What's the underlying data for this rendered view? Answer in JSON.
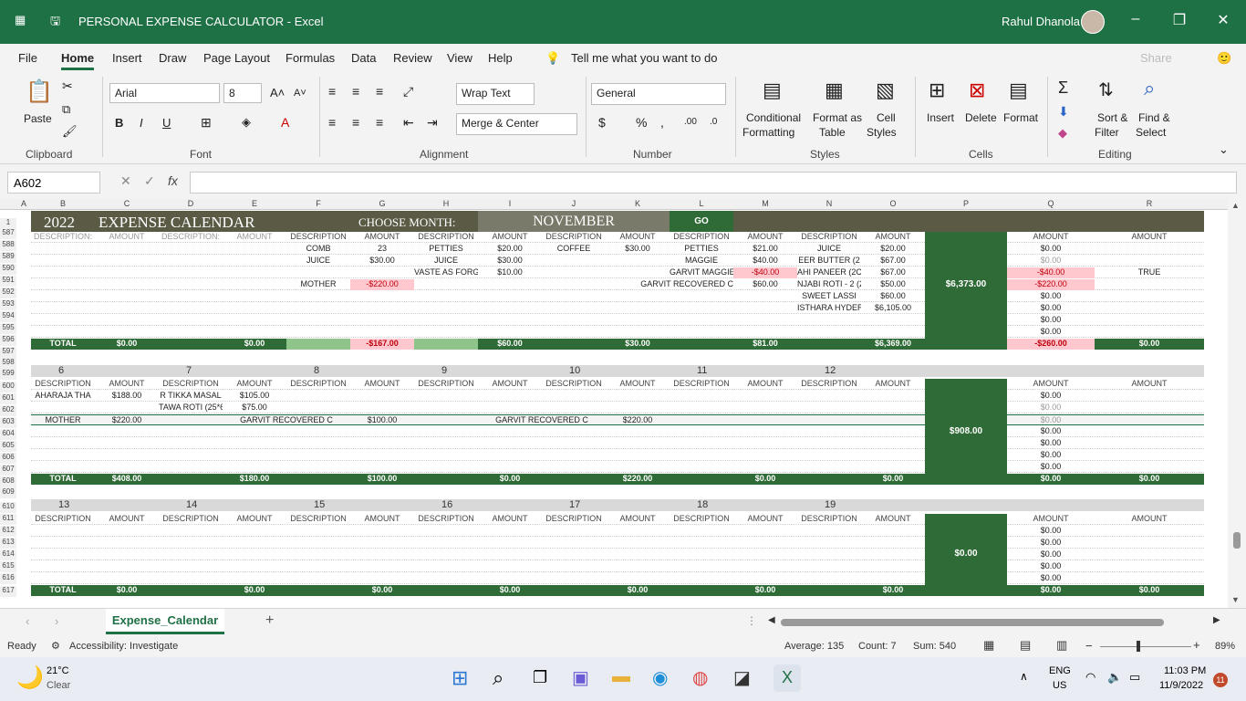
{
  "window": {
    "title": "PERSONAL EXPENSE CALCULATOR  -  Excel",
    "user": "Rahul Dhanola"
  },
  "menu": [
    "File",
    "Home",
    "Insert",
    "Draw",
    "Page Layout",
    "Formulas",
    "Data",
    "Review",
    "View",
    "Help",
    "Tell me what you want to do"
  ],
  "share": "Share",
  "ribbon": {
    "paste": "Paste",
    "clipboard": "Clipboard",
    "font_name": "Arial",
    "font_size": "8",
    "font": "Font",
    "wrap": "Wrap Text",
    "merge": "Merge & Center",
    "alignment": "Alignment",
    "number_format": "General",
    "number": "Number",
    "cond1": "Conditional",
    "cond2": "Formatting",
    "fmt1": "Format as",
    "fmt2": "Table",
    "cs1": "Cell",
    "cs2": "Styles",
    "styles": "Styles",
    "insert": "Insert",
    "delete": "Delete",
    "format": "Format",
    "cells": "Cells",
    "sort1": "Sort &",
    "sort2": "Filter",
    "find1": "Find &",
    "find2": "Select",
    "editing": "Editing"
  },
  "namebox": "A602",
  "columns": [
    "A",
    "B",
    "C",
    "D",
    "E",
    "F",
    "G",
    "H",
    "I",
    "J",
    "K",
    "L",
    "M",
    "N",
    "O",
    "P",
    "Q",
    "R"
  ],
  "banner": {
    "year": "2022",
    "title": "EXPENSE CALENDAR",
    "choose": "CHOOSE MONTH:",
    "month": "NOVEMBER",
    "go": "GO"
  },
  "headers": {
    "desc": "DESCRIPTION",
    "desc_short": "DESCRIPTION:",
    "amount": "AMOUNT",
    "total": "TOTAL"
  },
  "rows": {
    "r588": [
      "COMB",
      "23",
      "PETTIES",
      "$20.00",
      "COFFEE",
      "$30.00",
      "PETTIES",
      "$21.00",
      "JUICE",
      "$20.00",
      "$0.00"
    ],
    "r589": [
      "JUICE",
      "$30.00",
      "JUICE",
      "$30.00",
      "MAGGIE",
      "$40.00",
      "EER BUTTER (2",
      "$67.00",
      "$0.00"
    ],
    "r590": [
      "VASTE AS FORGI",
      "$10.00",
      "GARVIT MAGGIE",
      "-$40.00",
      "AHI PANEER (2C",
      "$67.00",
      "-$40.00",
      "TRUE"
    ],
    "r591": [
      "MOTHER",
      "-$220.00",
      "GARVIT RECOVERED C",
      "$60.00",
      "NJABI ROTI - 2 (2",
      "$50.00",
      "-$220.00"
    ],
    "r592": [
      "SWEET LASSI",
      "$60.00",
      "$0.00"
    ],
    "r593": [
      "ISTHARA HYDERABA",
      "$6,105.00",
      "$0.00"
    ],
    "total1": [
      "$0.00",
      "$0.00",
      "-$167.00",
      "$60.00",
      "$30.00",
      "$81.00",
      "$6,369.00",
      "-$260.00",
      "$0.00"
    ],
    "block1": "$6,373.00",
    "week2": [
      "6",
      "7",
      "8",
      "9",
      "10",
      "11",
      "12"
    ],
    "r600": [
      "AHARAJA THA",
      "$188.00",
      "R TIKKA MASAL",
      "$105.00",
      "$0.00"
    ],
    "r601": [
      "TAWA ROTI (25*6",
      "$75.00",
      "$0.00"
    ],
    "r602": [
      "MOTHER",
      "$220.00",
      "GARVIT RECOVERED C",
      "$100.00",
      "GARVIT RECOVERED C",
      "$220.00",
      "$0.00"
    ],
    "total2": [
      "$408.00",
      "$180.00",
      "$100.00",
      "$0.00",
      "$220.00",
      "$0.00",
      "$0.00",
      "$0.00",
      "$0.00"
    ],
    "block2": "$908.00",
    "week3": [
      "13",
      "14",
      "15",
      "16",
      "17",
      "18",
      "19"
    ],
    "total3": [
      "$0.00",
      "$0.00",
      "$0.00",
      "$0.00",
      "$0.00",
      "$0.00",
      "$0.00",
      "$0.00",
      "$0.00"
    ],
    "block3": "$0.00",
    "zero": "$0.00"
  },
  "rownums": [
    "1",
    "587",
    "588",
    "589",
    "590",
    "591",
    "592",
    "593",
    "594",
    "595",
    "596",
    "597",
    "598",
    "599",
    "600",
    "601",
    "602",
    "603",
    "604",
    "605",
    "606",
    "607",
    "608",
    "609",
    "610",
    "611",
    "612",
    "613",
    "614",
    "615",
    "616",
    "617"
  ],
  "sheet_tab": "Expense_Calendar",
  "status": {
    "ready": "Ready",
    "access": "Accessibility: Investigate",
    "avg": "Average: 135",
    "count": "Count: 7",
    "sum": "Sum: 540",
    "zoom": "89%"
  },
  "taskbar": {
    "temp": "21°C",
    "weather": "Clear",
    "lang1": "ENG",
    "lang2": "US",
    "time": "11:03 PM",
    "date": "11/9/2022",
    "badge": "11"
  },
  "colors": {
    "excel_green": "#1e7145",
    "total_green": "#2e6b36",
    "banner": "#5a5a45",
    "pink": "#ffc7ce"
  }
}
